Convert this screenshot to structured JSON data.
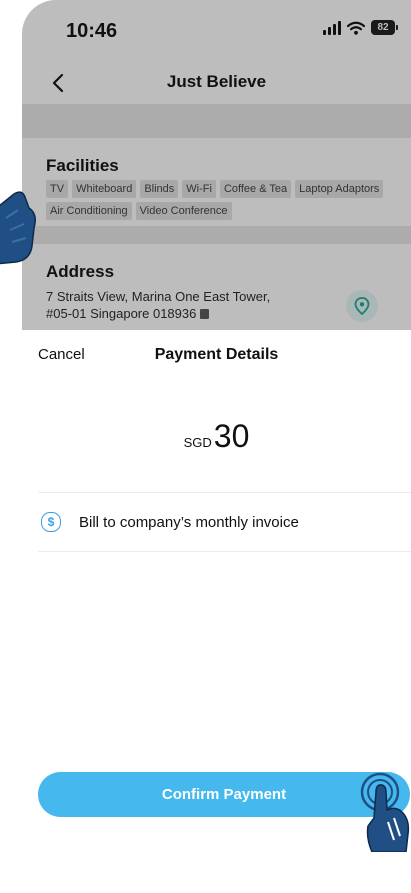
{
  "status_bar": {
    "time": "10:46",
    "battery": "82",
    "icons": [
      "signal-icon",
      "wifi-icon",
      "battery-icon"
    ]
  },
  "nav": {
    "back_icon": "chevron-left-icon",
    "title": "Just Believe"
  },
  "facilities": {
    "title": "Facilities",
    "tags": [
      "TV",
      "Whiteboard",
      "Blinds",
      "Wi-Fi",
      "Coffee & Tea",
      "Laptop Adaptors",
      "Air Conditioning",
      "Video Conference"
    ]
  },
  "address": {
    "title": "Address",
    "line1": "7 Straits View, Marina One East Tower,",
    "line2": "#05-01 Singapore 018936",
    "copy_icon": "copy-icon",
    "location_icon": "location-pin-icon"
  },
  "sheet": {
    "cancel_label": "Cancel",
    "title": "Payment Details",
    "currency": "SGD",
    "amount": "30",
    "payment_method": {
      "icon": "dollar-circle-icon",
      "label": "Bill to company’s monthly invoice"
    },
    "confirm_label": "Confirm Payment"
  },
  "colors": {
    "accent": "#45b8ee",
    "dim_overlay": "#bdbdbd",
    "hand": "#1f4f84"
  }
}
